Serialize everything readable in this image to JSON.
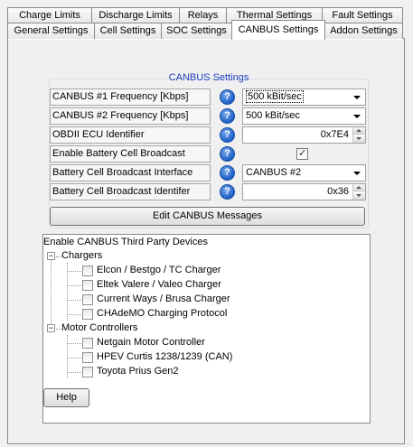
{
  "tabs_back": [
    "Charge Limits",
    "Discharge Limits",
    "Relays",
    "Thermal Settings",
    "Fault Settings"
  ],
  "tabs_front": [
    "General Settings",
    "Cell Settings",
    "SOC Settings",
    "CANBUS Settings",
    "Addon Settings"
  ],
  "active_tab": "CANBUS Settings",
  "group": {
    "title": "CANBUS Settings",
    "rows": [
      {
        "label": "CANBUS #1 Frequency [Kbps]",
        "type": "combo",
        "value": "500 kBit/sec"
      },
      {
        "label": "CANBUS #2 Frequency [Kbps]",
        "type": "combo",
        "value": "500 kBit/sec"
      },
      {
        "label": "OBDII ECU Identifier",
        "type": "spin",
        "value": "0x7E4"
      },
      {
        "label": "Enable Battery Cell Broadcast",
        "type": "checkbox",
        "checked": true
      },
      {
        "label": "Battery Cell Broadcast Interface",
        "type": "combo",
        "value": "CANBUS #2"
      },
      {
        "label": "Battery Cell Broadcast Identifer",
        "type": "spin",
        "value": "0x36"
      }
    ],
    "help_glyph": "?",
    "edit_button": "Edit CANBUS Messages"
  },
  "tree": {
    "title": "Enable CANBUS Third Party Devices",
    "expander_glyph": "−",
    "groups": [
      {
        "label": "Chargers",
        "items": [
          "Elcon / Bestgo / TC Charger",
          "Eltek Valere / Valeo Charger",
          "Current Ways / Brusa Charger",
          "CHAdeMO Charging Protocol"
        ]
      },
      {
        "label": "Motor Controllers",
        "items": [
          "Netgain Motor Controller",
          "HPEV Curtis 1238/1239 (CAN)",
          "Toyota Prius Gen2"
        ]
      }
    ]
  },
  "help_button": "Help"
}
